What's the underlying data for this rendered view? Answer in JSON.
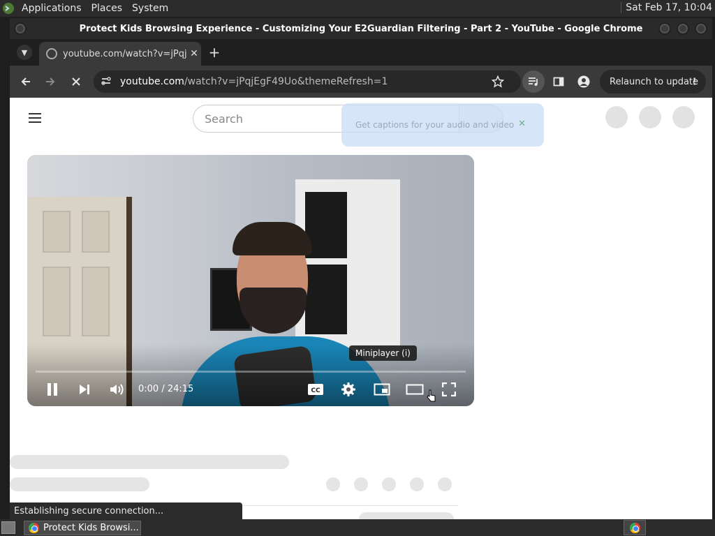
{
  "topbar": {
    "menus": [
      "Applications",
      "Places",
      "System"
    ],
    "clock": "Sat Feb 17, 10:04"
  },
  "window": {
    "title": "Protect Kids Browsing Experience - Customizing Your E2Guardian Filtering - Part 2 - YouTube - Google Chrome"
  },
  "tab": {
    "title": "youtube.com/watch?v=jPqjEg",
    "close": "✕",
    "new_tab": "+"
  },
  "toolbar": {
    "url_host": "youtube.com",
    "url_path": "/watch?v=jPqjEgF49Uo&themeRefresh=1",
    "relaunch_label": "Relaunch to update"
  },
  "youtube": {
    "search_placeholder": "Search",
    "captions_popup": "Get captions for your audio and video"
  },
  "player": {
    "time": "0:00 / 24:15",
    "tooltip": "Miniplayer (i)",
    "progress": 0
  },
  "status": {
    "text": "Establishing secure connection..."
  },
  "taskbar": {
    "item_label": "Protect Kids Browsi..."
  },
  "colors": {
    "accent": "#1a86b8",
    "chrome_dark": "#3a3a3a"
  }
}
